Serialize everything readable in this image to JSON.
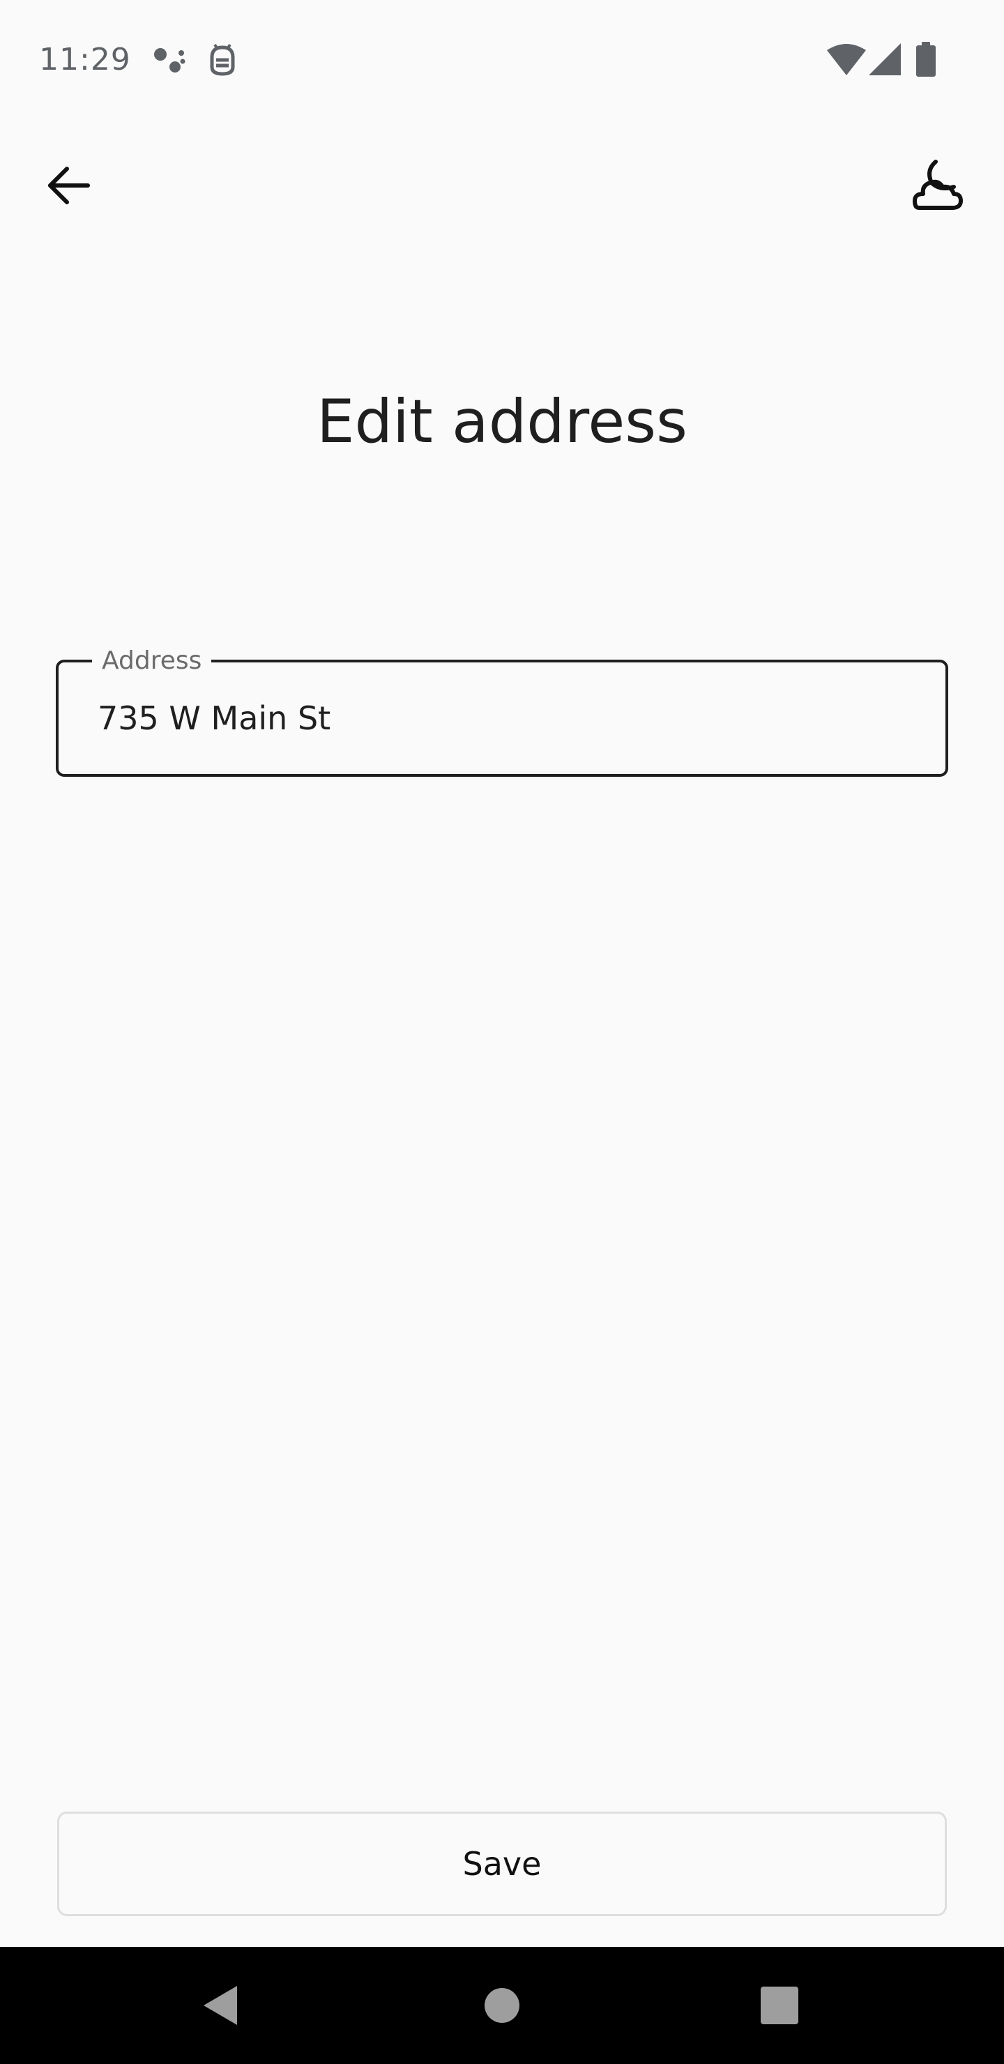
{
  "status_bar": {
    "time": "11:29",
    "icons": [
      "assistant-dots-icon",
      "android-debug-icon",
      "wifi-icon",
      "cell-signal-icon",
      "battery-icon"
    ]
  },
  "app_bar": {
    "back_icon": "arrow-back-icon",
    "theme_icon": "moon-cloud-icon"
  },
  "page": {
    "title": "Edit address"
  },
  "address_field": {
    "label": "Address",
    "value": "735 W Main St"
  },
  "actions": {
    "save_label": "Save"
  },
  "nav_bar": {
    "icons": [
      "nav-back-icon",
      "nav-home-icon",
      "nav-recents-icon"
    ]
  },
  "colors": {
    "background": "#fafafa",
    "text": "#1f1f1f",
    "field_border": "#1f1f1f",
    "button_border": "#dedede",
    "nav_bar": "#000000"
  }
}
